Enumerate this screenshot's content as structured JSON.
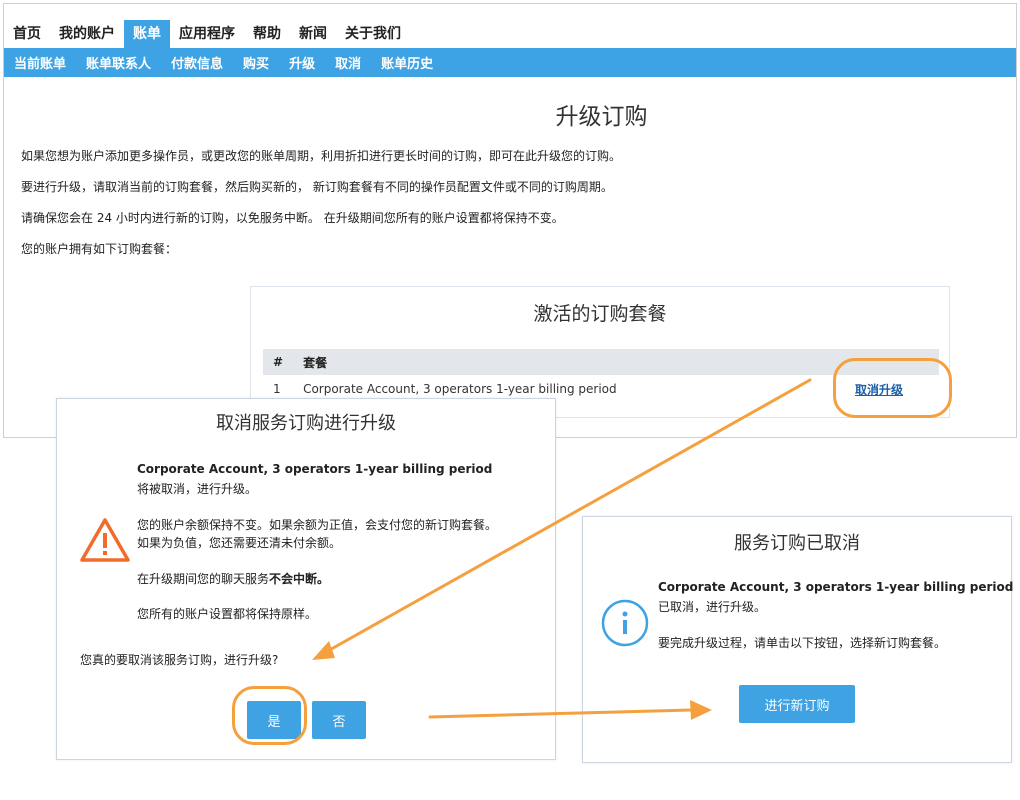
{
  "topnav": {
    "items": [
      "首页",
      "我的账户",
      "账单",
      "应用程序",
      "帮助",
      "新闻",
      "关于我们"
    ],
    "active_index": 2
  },
  "subnav": {
    "items": [
      "当前账单",
      "账单联系人",
      "付款信息",
      "购买",
      "升级",
      "取消",
      "账单历史"
    ]
  },
  "page": {
    "title": "升级订购",
    "paragraphs": [
      "如果您想为账户添加更多操作员，或更改您的账单周期，利用折扣进行更长时间的订购，即可在此升级您的订购。",
      "要进行升级，请取消当前的订购套餐，然后购买新的， 新订购套餐有不同的操作员配置文件或不同的订购周期。",
      "请确保您会在 24 小时内进行新的订购，以免服务中断。 在升级期间您所有的账户设置都将保持不变。",
      "您的账户拥有如下订购套餐："
    ]
  },
  "subscriptions": {
    "title": "激活的订购套餐",
    "columns": [
      "#",
      "套餐"
    ],
    "rows": [
      {
        "num": "1",
        "plan": "Corporate Account, 3 operators 1-year billing period",
        "action": "取消升级"
      }
    ]
  },
  "cancel_dialog": {
    "title": "取消服务订购进行升级",
    "plan_name": "Corporate Account, 3 operators 1-year billing period",
    "will_cancel": "将被取消，进行升级。",
    "balance_line1": "您的账户余额保持不变。如果余额为正值，会支付您的新订购套餐。",
    "balance_line2": "如果为负值，您还需要还清未付余额。",
    "chat_prefix": "在升级期间您的聊天服务",
    "chat_bold": "不会中断。",
    "settings_line": "您所有的账户设置都将保持原样。",
    "question": "您真的要取消该服务订购，进行升级?",
    "yes_label": "是",
    "no_label": "否",
    "icon": "warning-icon",
    "icon_color": "#f26b2a"
  },
  "cancelled_dialog": {
    "title": "服务订购已取消",
    "plan_name": "Corporate Account, 3 operators 1-year billing period",
    "cancelled_text": "已取消，进行升级。",
    "instruction": "要完成升级过程，请单击以下按钮，选择新订购套餐。",
    "button_label": "进行新订购",
    "icon": "info-icon",
    "icon_color": "#3fa2e3"
  },
  "colors": {
    "accent": "#3da3e4",
    "highlight": "#f5a03f"
  }
}
